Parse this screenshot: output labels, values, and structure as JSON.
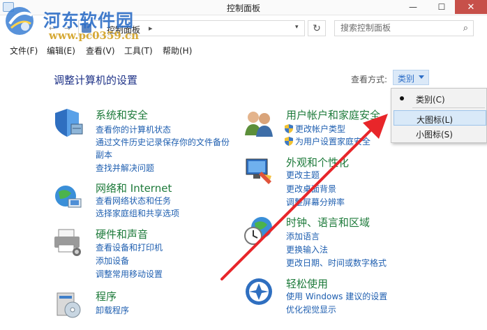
{
  "window": {
    "title": "控制面板",
    "minimize_glyph": "—",
    "maximize_glyph": "☐",
    "close_glyph": "✕"
  },
  "watermark": {
    "site_name": "河东软件园",
    "url": "www.pc0359.cn"
  },
  "addressbar": {
    "back_glyph": "←",
    "forward_glyph": "→",
    "breadcrumb": "控制面板",
    "separator": "▸",
    "dropdown_glyph": "▾",
    "refresh_glyph": "↻",
    "search_placeholder": "搜索控制面板",
    "search_glyph": "⌕"
  },
  "menubar": {
    "items": [
      "文件(F)",
      "编辑(E)",
      "查看(V)",
      "工具(T)",
      "帮助(H)"
    ]
  },
  "main": {
    "heading": "调整计算机的设置",
    "view_by_label": "查看方式:",
    "view_by_value": "类别"
  },
  "categories": [
    {
      "title": "系统和安全",
      "links": [
        "查看你的计算机状态",
        "通过文件历史记录保存你的文件备份",
        "副本",
        "查找并解决问题"
      ]
    },
    {
      "title": "网络和 Internet",
      "links": [
        "查看网络状态和任务",
        "选择家庭组和共享选项"
      ]
    },
    {
      "title": "硬件和声音",
      "links": [
        "查看设备和打印机",
        "添加设备",
        "调整常用移动设置"
      ]
    },
    {
      "title": "程序",
      "links": [
        "卸载程序"
      ]
    },
    {
      "title": "用户帐户和家庭安全",
      "links": [
        "更改帐户类型",
        "为用户设置家庭安全"
      ]
    },
    {
      "title": "外观和个性化",
      "links": [
        "更改主题",
        "更改桌面背景",
        "调整屏幕分辨率"
      ]
    },
    {
      "title": "时钟、语言和区域",
      "links": [
        "添加语言",
        "更换输入法",
        "更改日期、时间或数字格式"
      ]
    },
    {
      "title": "轻松使用",
      "links": [
        "使用 Windows 建议的设置",
        "优化视觉显示"
      ]
    }
  ],
  "view_dropdown": {
    "items": [
      "类别(C)",
      "大图标(L)",
      "小图标(S)"
    ],
    "selected_index": 0,
    "highlighted_index": 1
  },
  "colors": {
    "link": "#1f5fb0",
    "category_title": "#1d7a3a",
    "heading": "#1e3287",
    "arrow": "#e8262a",
    "watermark_blue": "#2d6ec7",
    "watermark_gold": "#d2a020",
    "close_button": "#c7504a"
  },
  "icons": [
    "control-panel-icon",
    "shield-icon",
    "globe-network-icon",
    "printer-icon",
    "program-disc-icon",
    "users-icon",
    "display-icon",
    "clock-globe-icon",
    "accessibility-icon",
    "search-icon",
    "refresh-icon"
  ]
}
